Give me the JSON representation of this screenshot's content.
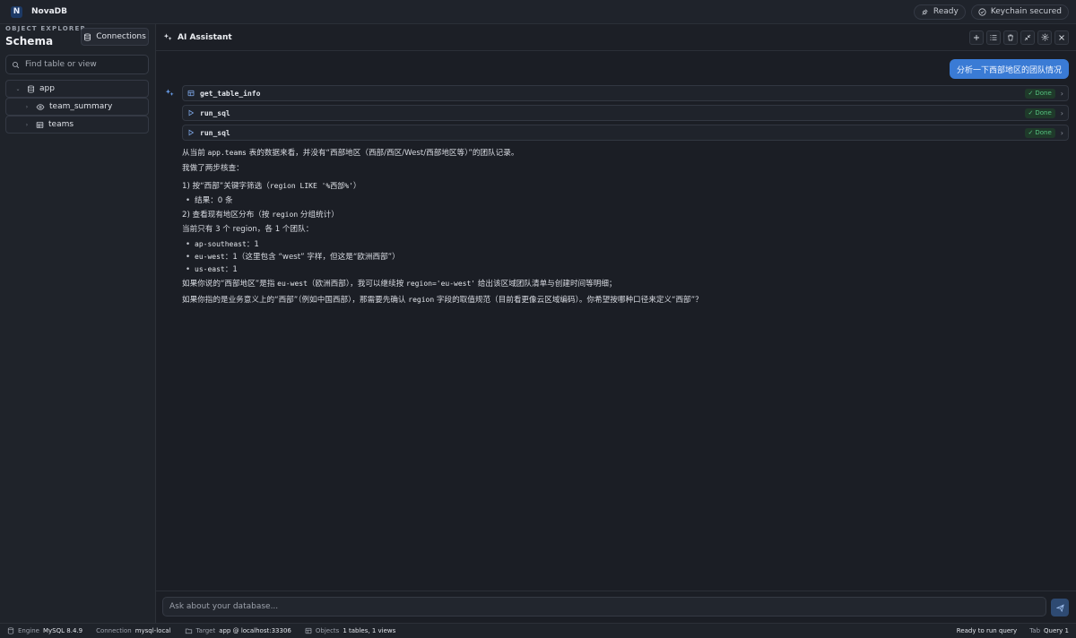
{
  "app": {
    "logo_letter": "N",
    "name": "NovaDB"
  },
  "titlebar": {
    "ready_label": "Ready",
    "keychain_label": "Keychain secured"
  },
  "sidebar": {
    "section_label": "OBJECT EXPLORER",
    "title": "Schema",
    "connections_label": "Connections",
    "search_placeholder": "Find table or view",
    "tree": [
      {
        "label": "app",
        "icon": "database-icon",
        "expanded": true
      },
      {
        "label": "team_summary",
        "icon": "eye-icon"
      },
      {
        "label": "teams",
        "icon": "table-icon"
      }
    ]
  },
  "assistant": {
    "title": "AI Assistant"
  },
  "chat": {
    "user_message": "分析一下西部地区的团队情况",
    "tools": [
      {
        "name": "get_table_info",
        "status": "Done",
        "icon": "table-icon"
      },
      {
        "name": "run_sql",
        "status": "Done",
        "icon": "play-icon"
      },
      {
        "name": "run_sql",
        "status": "Done",
        "icon": "play-icon"
      }
    ],
    "response": {
      "l1a": "从当前 ",
      "l1code": "app.teams",
      "l1b": " 表的数据来看，并没有“西部地区（西部/西区/West/西部地区等）”的团队记录。",
      "l2": "我做了两步核查：",
      "l3a": "1) 按“西部”关键字筛选（",
      "l3code": "region LIKE '%西部%'",
      "l3b": "）",
      "b1": "结果：0 条",
      "l4a": "2) 查看现有地区分布（按 ",
      "l4code": "region",
      "l4b": " 分组统计）",
      "l5": "当前只有 3 个 region，各 1 个团队：",
      "r1code": "ap-southeast",
      "r1": "：1",
      "r2code": "eu-west",
      "r2": "：1（这里包含 “west” 字样，但这是“欧洲西部”）",
      "r3code": "us-east",
      "r3": "：1",
      "l6a": "如果你说的“西部地区”是指 ",
      "l6code1": "eu-west",
      "l6b": "（欧洲西部），我可以继续按 ",
      "l6code2": "region='eu-west'",
      "l6c": " 给出该区域团队清单与创建时间等明细；",
      "l7a": "如果你指的是业务意义上的“西部”（例如中国西部），那需要先确认 ",
      "l7code": "region",
      "l7b": " 字段的取值规范（目前看更像云区域编码）。你希望按哪种口径来定义“西部”？"
    }
  },
  "composer": {
    "placeholder": "Ask about your database..."
  },
  "statusbar": {
    "engine_label": "Engine",
    "engine_value": "MySQL 8.4.9",
    "connection_label": "Connection",
    "connection_value": "mysql-local",
    "target_label": "Target",
    "target_value": "app @ localhost:33306",
    "objects_label": "Objects",
    "objects_value": "1 tables, 1 views",
    "run_status": "Ready to run query",
    "tab_label": "Tab",
    "tab_value": "Query 1"
  }
}
